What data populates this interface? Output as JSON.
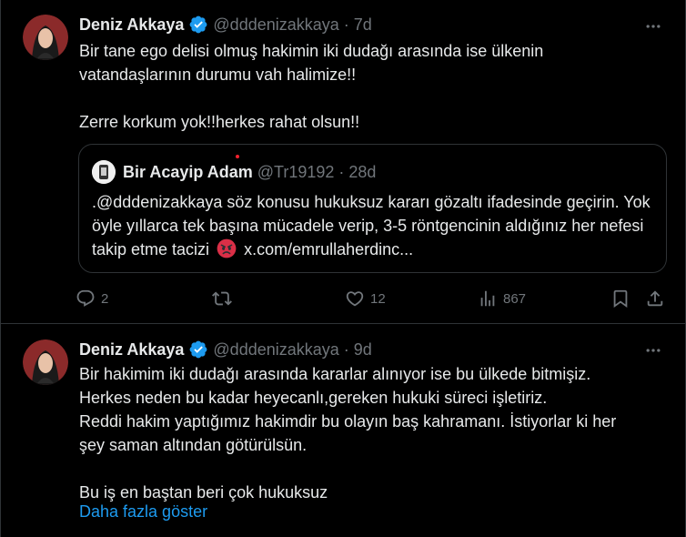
{
  "tweets": [
    {
      "name": "Deniz Akkaya",
      "handle": "@dddenizakkaya",
      "time": "7d",
      "text": "Bir tane ego delisi olmuş hakimin iki dudağı arasında ise ülkenin\nvatandaşlarının durumu vah halimize!!\n\nZerre korkum yok!!herkes rahat olsun!!",
      "quote": {
        "name": "Bir Acayip Adam",
        "handle": "@Tr19192",
        "time": "28d",
        "text_before_emoji": ".@dddenizakkaya söz konusu hukuksuz kararı gözaltı ifadesinde geçirin. Yok öyle yıllarca tek başına mücadele verip, 3-5 röntgencinin aldığınız her nefesi takip etme tacizi",
        "link": "x.com/emrullaherdinc..."
      },
      "actions": {
        "replies": "2",
        "likes": "12",
        "views": "867"
      }
    },
    {
      "name": "Deniz Akkaya",
      "handle": "@dddenizakkaya",
      "time": "9d",
      "text": "Bir hakimim iki dudağı arasında kararlar alınıyor ise bu ülkede bitmişiz.\nHerkes neden bu kadar heyecanlı,gereken hukuki süreci işletiriz.\nReddi hakim yaptığımız hakimdir bu olayın baş kahramanı. İstiyorlar ki her\nşey saman altından götürülsün.\n\nBu iş en baştan beri çok hukuksuz",
      "show_more": "Daha fazla göster"
    }
  ],
  "dot": "·",
  "icons": {
    "verified": "verified-badge-icon",
    "more": "more-icon",
    "reply": "reply-icon",
    "retweet": "retweet-icon",
    "like": "like-icon",
    "views": "views-icon",
    "bookmark": "bookmark-icon",
    "share": "share-icon",
    "emoji": "angry-face-emoji"
  },
  "colors": {
    "background": "#000000",
    "text": "#e7e9ea",
    "muted": "#71767b",
    "accent": "#1d9bf0",
    "border": "#2f3336"
  }
}
